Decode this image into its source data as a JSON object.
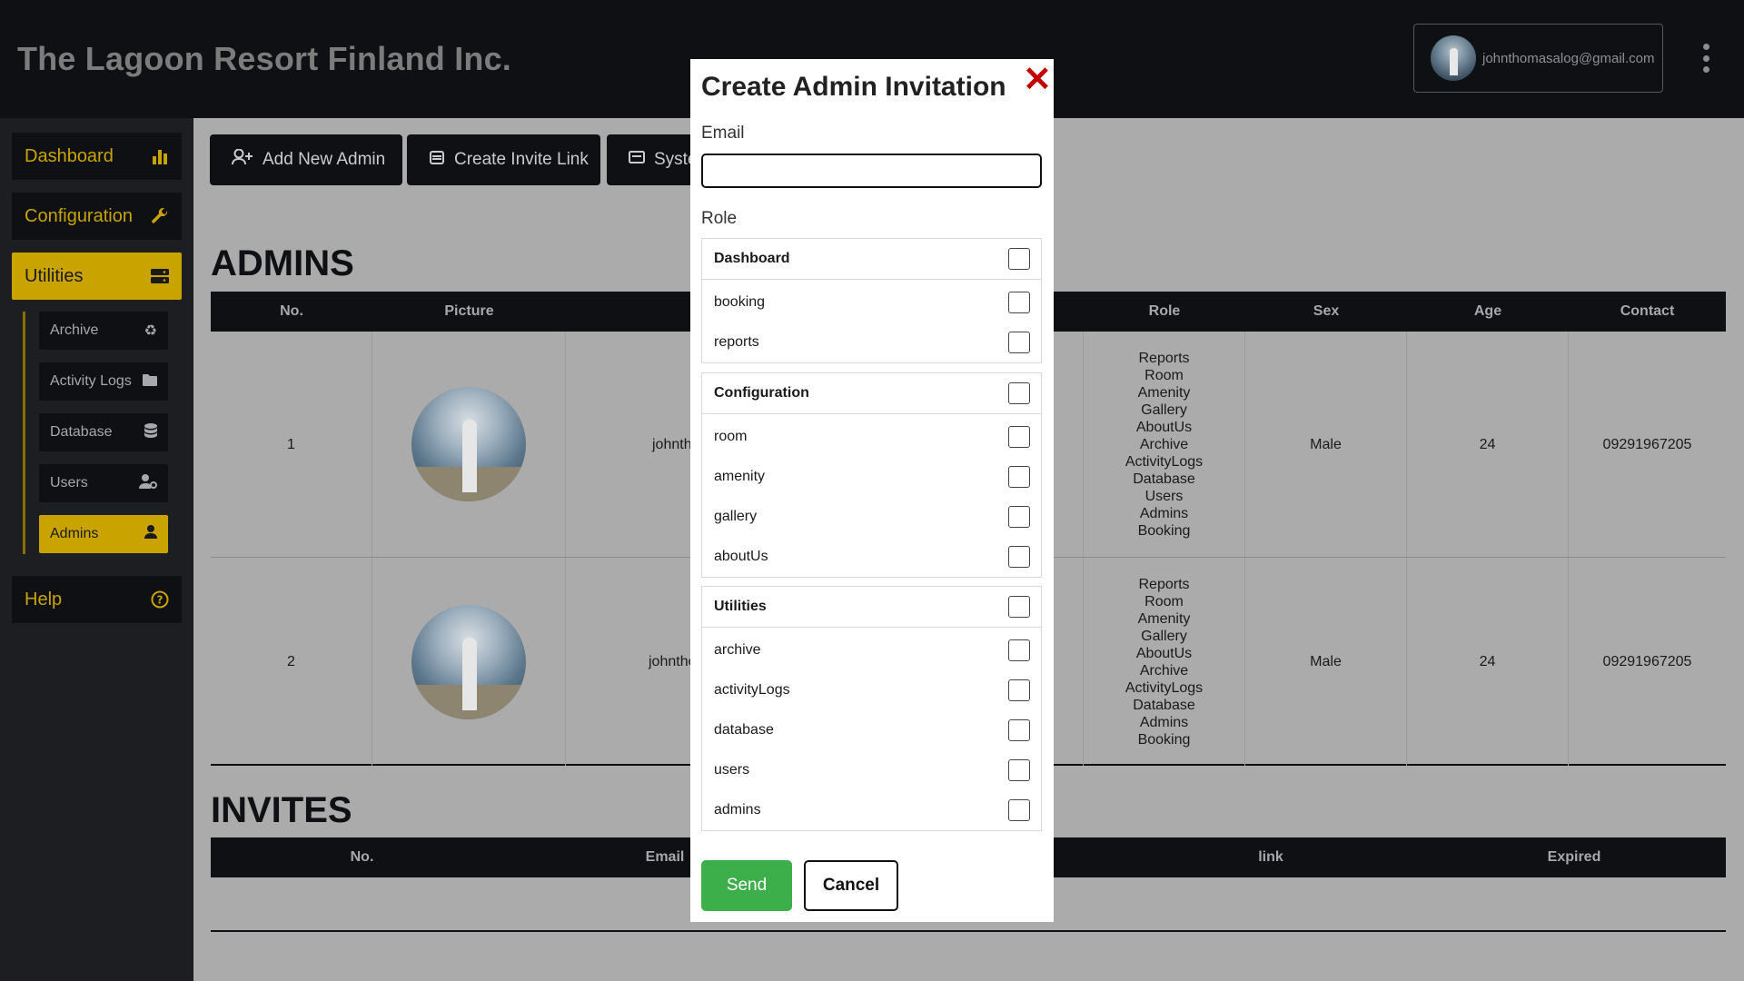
{
  "header": {
    "title": "The Lagoon Resort Finland Inc.",
    "user_email": "johnthomasalog@gmail.com",
    "menu_icon": "kebab-menu-icon"
  },
  "sidebar": {
    "items": [
      {
        "label": "Dashboard",
        "icon": "bar-chart-icon"
      },
      {
        "label": "Configuration",
        "icon": "wrench-icon"
      },
      {
        "label": "Utilities",
        "icon": "server-icon",
        "active": true
      },
      {
        "label": "Help",
        "icon": "question-circle-icon"
      }
    ],
    "sub_items": [
      {
        "label": "Archive",
        "icon": "recycle-icon"
      },
      {
        "label": "Activity Logs",
        "icon": "folder-icon"
      },
      {
        "label": "Database",
        "icon": "database-icon"
      },
      {
        "label": "Users",
        "icon": "user-gear-icon"
      },
      {
        "label": "Admins",
        "icon": "user-icon",
        "active": true
      }
    ]
  },
  "toolbar": {
    "add_admin": "Add New Admin",
    "create_invite": "Create Invite Link",
    "system": "System"
  },
  "admins": {
    "title": "ADMINS",
    "columns": [
      "No.",
      "Picture",
      "",
      "Role",
      "Sex",
      "Age",
      "Contact"
    ],
    "rows": [
      {
        "no": "1",
        "name": "johnthomasalog",
        "roles": [
          "Reports",
          "Room",
          "Amenity",
          "Gallery",
          "AboutUs",
          "Archive",
          "ActivityLogs",
          "Database",
          "Users",
          "Admins",
          "Booking"
        ],
        "sex": "Male",
        "age": "24",
        "contact": "09291967205"
      },
      {
        "no": "2",
        "name": "johnthomasalog",
        "roles": [
          "Reports",
          "Room",
          "Amenity",
          "Gallery",
          "AboutUs",
          "Archive",
          "ActivityLogs",
          "Database",
          "Admins",
          "Booking"
        ],
        "sex": "Male",
        "age": "24",
        "contact": "09291967205"
      }
    ]
  },
  "invites": {
    "title": "INVITES",
    "columns": [
      "No.",
      "Email",
      "link",
      "Expired"
    ]
  },
  "modal": {
    "title": "Create Admin Invitation",
    "close_icon": "close-x-icon",
    "email_label": "Email",
    "email_value": "",
    "email_placeholder": "",
    "role_label": "Role",
    "groups": [
      {
        "name": "Dashboard",
        "items": [
          "booking",
          "reports"
        ]
      },
      {
        "name": "Configuration",
        "items": [
          "room",
          "amenity",
          "gallery",
          "aboutUs"
        ]
      },
      {
        "name": "Utilities",
        "items": [
          "archive",
          "activityLogs",
          "database",
          "users",
          "admins"
        ]
      }
    ],
    "send_label": "Send",
    "cancel_label": "Cancel"
  },
  "colors": {
    "accent": "#c9a400",
    "dark": "#0e1014",
    "send": "#3cae4a",
    "close": "#c40000"
  }
}
